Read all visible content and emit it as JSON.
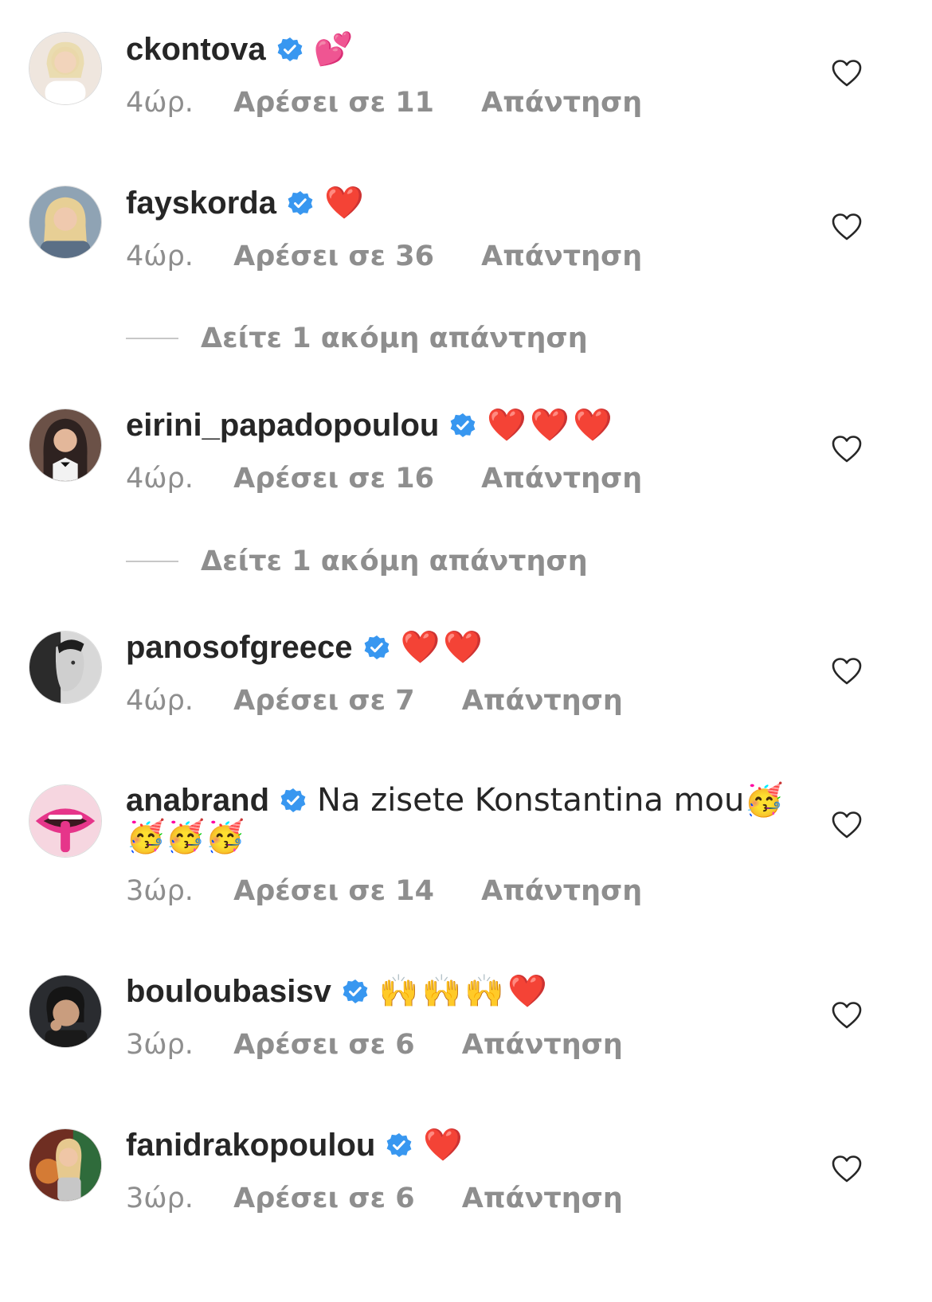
{
  "comments": [
    {
      "username": "ckontova",
      "text": "💕",
      "time": "4ώρ.",
      "likes": "Αρέσει σε 11",
      "reply": "Απάντηση",
      "avatar_color": "#e9e0d8"
    },
    {
      "username": "fayskorda",
      "text": "❤️",
      "time": "4ώρ.",
      "likes": "Αρέσει σε 36",
      "reply": "Απάντηση",
      "avatar_color": "#b9a58e"
    },
    {
      "username": "eirini_papadopoulou",
      "text": "❤️❤️❤️",
      "time": "4ώρ.",
      "likes": "Αρέσει σε 16",
      "reply": "Απάντηση",
      "avatar_color": "#4a3a33"
    },
    {
      "username": "panosofgreece",
      "text": "❤️❤️",
      "time": "4ώρ.",
      "likes": "Αρέσει σε 7",
      "reply": "Απάντηση",
      "avatar_color": "#9a9a9a"
    },
    {
      "username": "anabrand",
      "text": "Na zisete Konstantina mou🥳",
      "text_cont": "🥳🥳🥳",
      "time": "3ώρ.",
      "likes": "Αρέσει σε 14",
      "reply": "Απάντηση",
      "avatar_color": "#e23e8e"
    },
    {
      "username": "bouloubasisv",
      "text": "🙌🙌🙌❤️",
      "time": "3ώρ.",
      "likes": "Αρέσει σε 6",
      "reply": "Απάντηση",
      "avatar_color": "#3c3a3a"
    },
    {
      "username": "fanidrakopoulou",
      "text": "❤️",
      "time": "3ώρ.",
      "likes": "Αρέσει σε 6",
      "reply": "Απάντηση",
      "avatar_color": "#c0743c"
    }
  ],
  "view_more": [
    {
      "label": "Δείτε 1 ακόμη απάντηση"
    },
    {
      "label": "Δείτε 1 ακόμη απάντηση"
    }
  ],
  "colors": {
    "verified": "#3897f0",
    "muted": "#8e8e8e",
    "heart_emoji": "#ed1c24"
  }
}
